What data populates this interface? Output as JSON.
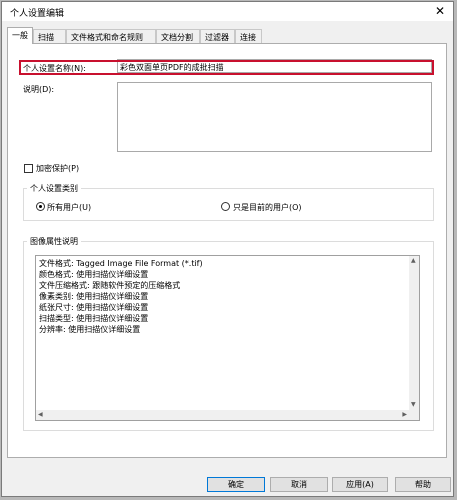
{
  "window": {
    "title": "个人设置编辑",
    "close_glyph": "✕"
  },
  "tabs": [
    {
      "label": "一般",
      "active": true
    },
    {
      "label": "扫描"
    },
    {
      "label": "文件格式和命名规则"
    },
    {
      "label": "文档分割"
    },
    {
      "label": "过滤器"
    },
    {
      "label": "连接"
    }
  ],
  "general": {
    "name_label": "个人设置名称(N):",
    "name_value": "彩色双面单页PDF的成批扫描",
    "description_label": "说明(D):",
    "description_value": "",
    "encrypt_label": "加密保护(P)",
    "encrypt_checked": false,
    "category_legend": "个人设置类别",
    "radio_all_users": "所有用户(U)",
    "radio_current_user": "只是目前的用户(O)",
    "all_users_selected": true,
    "image_props_legend": "图像属性说明",
    "image_props_lines": [
      "文件格式: Tagged Image File Format (*.tif)",
      "颜色格式: 使用扫描仪详细设置",
      "文件压缩格式:          跟随软件预定的压缩格式",
      "像素类别: 使用扫描仪详细设置",
      "纸张尺寸: 使用扫描仪详细设置",
      "扫描类型: 使用扫描仪详细设置",
      "分辨率:                使用扫描仪详细设置"
    ]
  },
  "buttons": {
    "ok": "确定",
    "cancel": "取消",
    "apply": "应用(A)",
    "help": "帮助"
  },
  "scroll_arrows": {
    "up": "▲",
    "down": "▼",
    "left": "◀",
    "right": "▶"
  },
  "colors": {
    "highlight": "#c8102e",
    "default_button_border": "#0078d7"
  }
}
